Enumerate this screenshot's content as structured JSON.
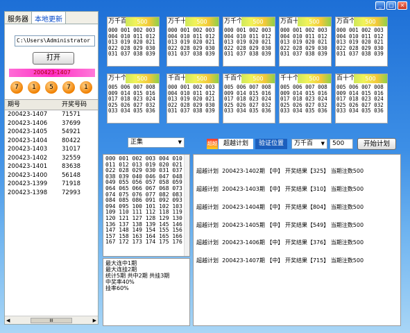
{
  "window": {
    "buttons": [
      "_",
      "□",
      "×"
    ]
  },
  "left": {
    "tabs": [
      "服务器",
      "本地更新"
    ],
    "path_value": "C:\\Users\\Administrator",
    "open_button": "打开",
    "period": "200423-1407",
    "balls": [
      "7",
      "1",
      "5",
      "7",
      "1"
    ],
    "table_headers": [
      "期号",
      "开奖号码"
    ],
    "rows": [
      [
        "200423-1407",
        "71571"
      ],
      [
        "200423-1406",
        "37699"
      ],
      [
        "200423-1405",
        "54921"
      ],
      [
        "200423-1404",
        "80422"
      ],
      [
        "200423-1403",
        "31017"
      ],
      [
        "200423-1402",
        "32559"
      ],
      [
        "200423-1401",
        "83638"
      ],
      [
        "200423-1400",
        "56148"
      ],
      [
        "200423-1399",
        "71918"
      ],
      [
        "200423-1398",
        "72993"
      ]
    ],
    "scroll_label": "III"
  },
  "panels": [
    {
      "title": "万千百",
      "value": "500",
      "grid": "000 001 002 003\n004 010 011 012\n013 019 020 021\n022 028 029 030\n031 037 038 039"
    },
    {
      "title": "万千十",
      "value": "500",
      "grid": "000 001 002 003\n004 010 011 012\n013 019 020 021\n022 028 029 030\n031 037 038 039"
    },
    {
      "title": "万千个",
      "value": "500",
      "grid": "000 001 002 003\n004 010 011 012\n013 019 020 021\n022 028 029 030\n031 037 038 039"
    },
    {
      "title": "万百十",
      "value": "500",
      "grid": "000 001 002 003\n004 010 011 012\n013 019 020 021\n022 028 029 030\n031 037 038 039"
    },
    {
      "title": "万百个",
      "value": "500",
      "grid": "000 001 002 003\n004 010 011 012\n013 019 020 021\n022 028 029 030\n031 037 038 039"
    },
    {
      "title": "万十个",
      "value": "500",
      "grid": "005 006 007 008\n009 014 015 016\n017 018 023 024\n025 026 027 032\n033 034 035 036"
    },
    {
      "title": "千百十",
      "value": "500",
      "grid": "000 001 002 003\n004 010 011 012\n013 019 020 021\n022 028 029 030\n031 037 038 039"
    },
    {
      "title": "千百个",
      "value": "500",
      "grid": "005 006 007 008\n009 014 015 016\n017 018 023 024\n025 026 027 032\n033 034 035 036"
    },
    {
      "title": "千十个",
      "value": "500",
      "grid": "005 006 007 008\n009 014 015 016\n017 018 023 024\n025 026 027 032\n033 034 035 036"
    },
    {
      "title": "百十个",
      "value": "500",
      "grid": "005 006 007 008\n009 014 015 016\n017 018 023 024\n025 026 027 032\n033 034 035 036"
    }
  ],
  "controls": {
    "mode_select": "正集",
    "plan_badge": "超越",
    "plan_label": "超越计划",
    "verify_label": "验证位置",
    "position_select": "万千百",
    "count_input": "500",
    "start_button": "开始计划"
  },
  "numbers_box": "000 001 002 003 004 010\n011 012 013 019 020 021\n022 028 029 030 031 037\n038 039 040 046 047 048\n049 055 056 057 058 059\n064 065 066 067 068 073\n074 075 076 077 082 083\n084 085 086 091 092 093\n094 095 100 101 102 103\n109 110 111 112 118 119\n120 121 127 128 129 130\n136 137 138 139 145 146\n147 148 149 154 155 156\n157 158 163 164 165 166\n167 172 173 174 175 176",
  "stats_box": "最大连中1期\n最大连挂2期\n统计5期 共中2期 共挂3期\n中奖率40%\n挂率60%",
  "results": [
    "超越计划  200423-1402期 【中】 开奖结果【325】 当期注数500",
    "超越计划  200423-1403期 【中】 开奖结果【310】 当期注数500",
    "超越计划  200423-1404期 【中】 开奖结果【804】 当期注数500",
    "超越计划  200423-1405期 【中】 开奖结果【549】 当期注数500",
    "超越计划  200423-1406期 【中】 开奖结果【376】 当期注数500",
    "超越计划  200423-1407期 【中】 开奖结果【715】 当期注数500"
  ]
}
